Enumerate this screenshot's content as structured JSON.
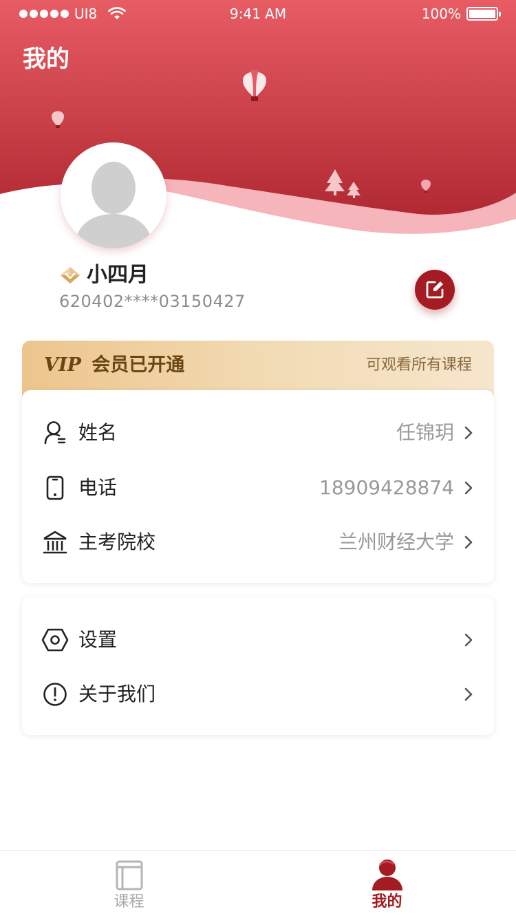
{
  "status_bar": {
    "carrier": "UI8",
    "time": "9:41 AM",
    "battery": "100%"
  },
  "page_title": "我的",
  "profile": {
    "name": "小四月",
    "id_number": "620402****03150427"
  },
  "vip": {
    "tag": "VIP",
    "status": "会员已开通",
    "benefit": "可观看所有课程"
  },
  "info_rows": [
    {
      "label": "姓名",
      "value": "任锦玥",
      "icon": "user-icon"
    },
    {
      "label": "电话",
      "value": "18909428874",
      "icon": "phone-icon"
    },
    {
      "label": "主考院校",
      "value": "兰州财经大学",
      "icon": "school-icon"
    }
  ],
  "settings_rows": [
    {
      "label": "设置",
      "icon": "settings-icon"
    },
    {
      "label": "关于我们",
      "icon": "info-icon"
    }
  ],
  "tabbar": {
    "tabs": [
      {
        "label": "课程",
        "icon": "course-book-icon",
        "active": false
      },
      {
        "label": "我的",
        "icon": "profile-person-icon",
        "active": true
      }
    ]
  },
  "colors": {
    "brand_red": "#a51b22",
    "header_red": "#e55a62",
    "vip_gold": "#ecc58c",
    "muted_text": "#999999"
  }
}
